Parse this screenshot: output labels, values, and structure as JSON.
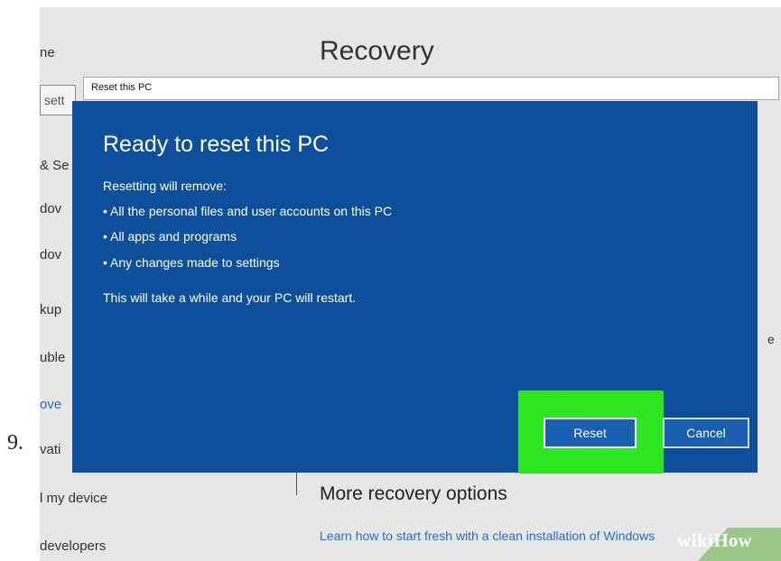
{
  "step_number": "9.",
  "window": {
    "title": "Recovery",
    "sidebar": [
      {
        "label": "ne",
        "active": false
      },
      {
        "label": "& Se",
        "active": false
      },
      {
        "label": "dov",
        "active": false
      },
      {
        "label": "dov",
        "active": false
      },
      {
        "label": "kup",
        "active": false
      },
      {
        "label": "uble",
        "active": false
      },
      {
        "label": "ove",
        "active": true
      },
      {
        "label": "vati",
        "active": false
      },
      {
        "label": "l my device",
        "active": false
      },
      {
        "label": "developers",
        "active": false
      }
    ],
    "sidebar_search_text": "sett",
    "right_clipped_text": "e",
    "more_recovery": {
      "title": "More recovery options",
      "link": "Learn how to start fresh with a clean installation of Windows"
    }
  },
  "dialog": {
    "title_bar": "Reset this PC",
    "heading": "Ready to reset this PC",
    "intro": "Resetting will remove:",
    "bullets": [
      "• All the personal files and user accounts on this PC",
      "• All apps and programs",
      "• Any changes made to settings"
    ],
    "note": "This will take a while and your PC will restart.",
    "reset_button": "Reset",
    "cancel_button": "Cancel",
    "highlight_color": "#2ee61f",
    "accent_color": "#0d4f9a"
  },
  "watermark": {
    "part1": "wiki",
    "part2": "How"
  }
}
